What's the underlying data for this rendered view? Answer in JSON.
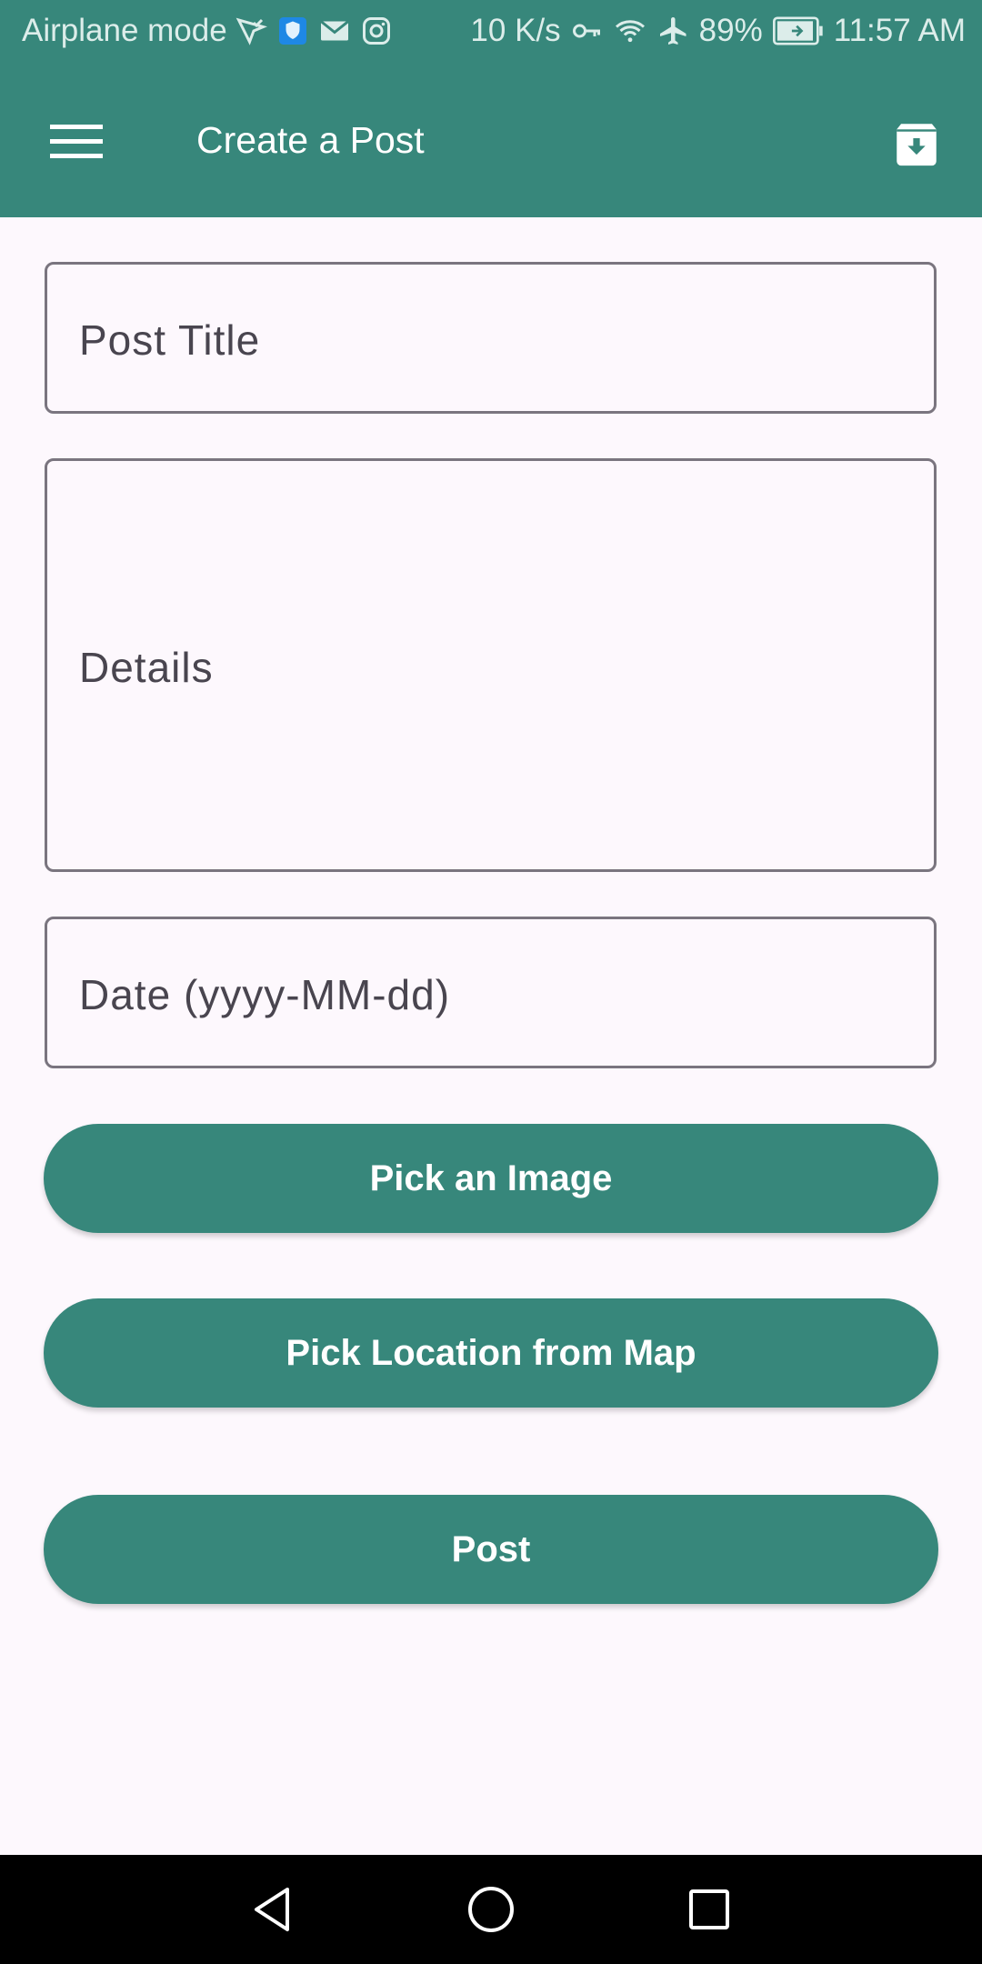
{
  "status_bar": {
    "mode_text": "Airplane mode",
    "net_speed": "10 K/s",
    "battery": "89%",
    "time": "11:57 AM",
    "icons": [
      "vpn-check-icon",
      "shield-icon",
      "mail-icon",
      "instagram-icon",
      "key-icon",
      "wifi-icon",
      "airplane-icon",
      "battery-icon"
    ]
  },
  "app_bar": {
    "title": "Create a Post",
    "menu_icon": "menu-icon",
    "action_icon": "archive-download-icon",
    "color": "#37877B"
  },
  "form": {
    "title_placeholder": "Post Title",
    "details_placeholder": "Details",
    "date_placeholder": "Date (yyyy-MM-dd)"
  },
  "buttons": {
    "pick_image": "Pick an Image",
    "pick_location": "Pick Location from Map",
    "post": "Post"
  },
  "nav_bar": {
    "icons": [
      "back-icon",
      "home-icon",
      "recents-icon"
    ]
  }
}
